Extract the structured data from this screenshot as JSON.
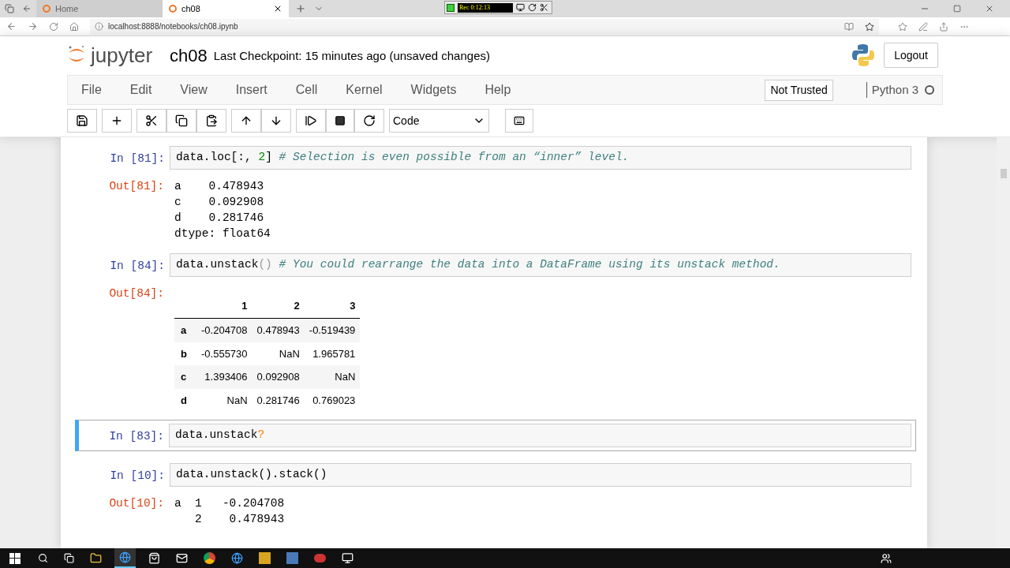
{
  "browser": {
    "tabs": [
      {
        "title": "Home",
        "selected": false
      },
      {
        "title": "ch08",
        "selected": true
      }
    ],
    "url": "localhost:8888/notebooks/ch08.ipynb"
  },
  "recorder": {
    "time": "Rec 0:12:13"
  },
  "header": {
    "logo": "jupyter",
    "notebook_name": "ch08",
    "checkpoint": "Last Checkpoint: 15 minutes ago (unsaved changes)",
    "logout": "Logout"
  },
  "menu": [
    "File",
    "Edit",
    "View",
    "Insert",
    "Cell",
    "Kernel",
    "Widgets",
    "Help"
  ],
  "trusted": "Not Trusted",
  "kernel": {
    "name": "Python 3",
    "busy": false
  },
  "toolbar": {
    "cell_type": "Code"
  },
  "cells": [
    {
      "prompt": "In [81]:",
      "selected": false,
      "code": [
        {
          "kind": "code",
          "text": "data.loc[:, "
        },
        {
          "kind": "number",
          "text": "2"
        },
        {
          "kind": "code",
          "text": "] "
        },
        {
          "kind": "comment",
          "text": "# Selection is even possible from an “inner” level."
        }
      ],
      "output": {
        "prompt": "Out[81]:",
        "kind": "text",
        "lines": [
          "a    0.478943",
          "c    0.092908",
          "d    0.281746",
          "dtype: float64"
        ]
      }
    },
    {
      "prompt": "In [84]:",
      "selected": false,
      "code": [
        {
          "kind": "code",
          "text": "data.unstack"
        },
        {
          "kind": "bracket",
          "text": "() "
        },
        {
          "kind": "comment",
          "text": "# You could rearrange the data into a DataFrame using its unstack method."
        }
      ],
      "output": {
        "prompt": "Out[84]:",
        "kind": "table",
        "columns": [
          "1",
          "2",
          "3"
        ],
        "rows": [
          {
            "index": "a",
            "cells": [
              "-0.204708",
              "0.478943",
              "-0.519439"
            ]
          },
          {
            "index": "b",
            "cells": [
              "-0.555730",
              "NaN",
              "1.965781"
            ]
          },
          {
            "index": "c",
            "cells": [
              "1.393406",
              "0.092908",
              "NaN"
            ]
          },
          {
            "index": "d",
            "cells": [
              "NaN",
              "0.281746",
              "0.769023"
            ]
          }
        ]
      }
    },
    {
      "prompt": "In [83]:",
      "selected": true,
      "code": [
        {
          "kind": "code",
          "text": "data.unstack"
        },
        {
          "kind": "operator",
          "text": "?"
        }
      ]
    },
    {
      "prompt": "In [10]:",
      "selected": false,
      "code": [
        {
          "kind": "code",
          "text": "data.unstack().stack()"
        }
      ],
      "output": {
        "prompt": "Out[10]:",
        "kind": "text",
        "lines": [
          "a  1   -0.204708",
          "   2    0.478943"
        ]
      }
    }
  ]
}
